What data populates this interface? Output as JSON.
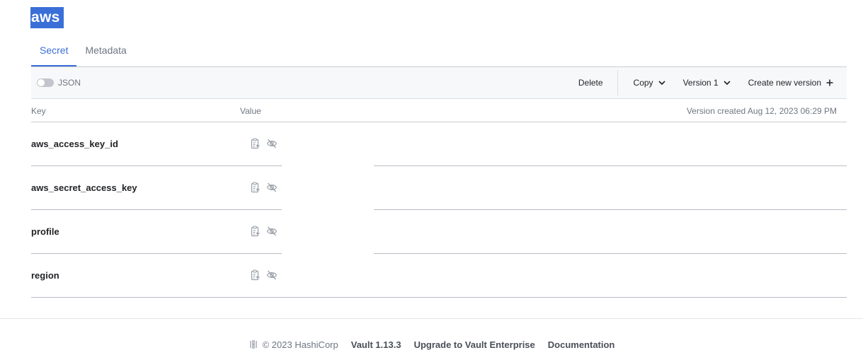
{
  "page": {
    "title": "aws"
  },
  "tabs": [
    {
      "label": "Secret",
      "active": true
    },
    {
      "label": "Metadata",
      "active": false
    }
  ],
  "toolbar": {
    "json_toggle_label": "JSON",
    "delete_label": "Delete",
    "copy_label": "Copy",
    "version_label": "Version 1",
    "create_label": "Create new version"
  },
  "table": {
    "key_header": "Key",
    "value_header": "Value",
    "version_created": "Version created Aug 12, 2023 06:29 PM",
    "rows": [
      {
        "key": "aws_access_key_id"
      },
      {
        "key": "aws_secret_access_key"
      },
      {
        "key": "profile"
      },
      {
        "key": "region"
      }
    ]
  },
  "footer": {
    "copyright": "© 2023 HashiCorp",
    "version": "Vault 1.13.3",
    "upgrade_link": "Upgrade to Vault Enterprise",
    "docs_link": "Documentation"
  },
  "colors": {
    "accent": "#3b6fd8",
    "text": "#1f2124",
    "muted": "#6f7682"
  }
}
